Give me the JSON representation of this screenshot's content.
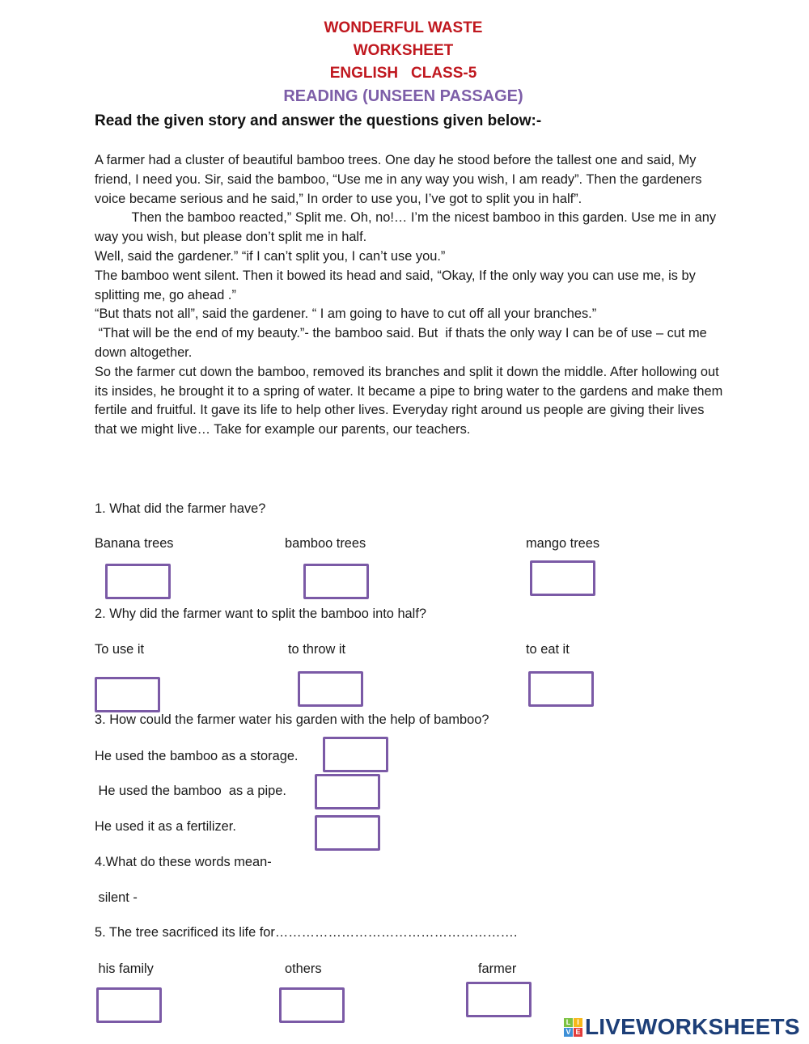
{
  "header": {
    "title_line1": "WONDERFUL WASTE",
    "title_line2": "WORKSHEET",
    "title_line3": "ENGLISH   CLASS-5",
    "subtitle": "READING (UNSEEN PASSAGE)"
  },
  "instructions": "Read the given story and answer the questions given below:-",
  "passage": [
    "A farmer had a cluster of beautiful bamboo trees. One day he stood before the tallest one and said, My friend, I need you. Sir, said the bamboo, “Use me in any way you wish, I am ready”. Then the gardeners voice became serious and he said,” In order to use you, I’ve got to split you in half”.",
    "          Then the bamboo reacted,” Split me. Oh, no!… I’m the nicest bamboo in this garden. Use me in any way you wish, but please don’t split me in half.",
    "Well, said the gardener.” “if I can’t split you, I can’t use you.”",
    "The bamboo went silent. Then it bowed its head and said, “Okay, If the only way you can use me, is by splitting me, go ahead .”",
    "“But thats not all”, said the gardener. “ I am going to have to cut off all your branches.”",
    " “That will be the end of my beauty.”- the bamboo said. But  if thats the only way I can be of use – cut me down altogether.",
    "So the farmer cut down the bamboo, removed its branches and split it down the middle. After hollowing out its insides, he brought it to a spring of water. It became a pipe to bring water to the gardens and make them fertile and fruitful. It gave its life to help other lives. Everyday right around us people are giving their lives that we might live… Take for example our parents, our teachers."
  ],
  "questions": [
    {
      "text": "1. What did the farmer have?",
      "options": [
        "Banana trees",
        "bamboo trees",
        "mango trees"
      ]
    },
    {
      "text": "2. Why did the farmer want to split the bamboo into half?",
      "options": [
        "To use it",
        "to throw it",
        "to eat it"
      ]
    },
    {
      "text": "3. How could the farmer water his garden with the help of bamboo?",
      "options": [
        "He used the bamboo as a storage.",
        " He used the bamboo  as a pipe.",
        "He used it as a fertilizer."
      ]
    },
    {
      "text": "4.What do these words mean-",
      "words": [
        " silent -"
      ]
    },
    {
      "text": "5. The tree sacrificed its life for……………………………………………….",
      "options": [
        " his family",
        "others",
        "farmer"
      ]
    }
  ],
  "branding": {
    "logo_letters": [
      "L",
      "I",
      "V",
      "E"
    ],
    "logo_colors": [
      "#7cc242",
      "#f6b81a",
      "#3d8fd6",
      "#e23c3c"
    ],
    "logo_text": "LIVEWORKSHEETS"
  },
  "colors": {
    "title_red": "#c0181f",
    "subtitle_purple": "#7d5ea8",
    "box_border": "#7b5aa6",
    "logo_navy": "#1d3f78"
  }
}
